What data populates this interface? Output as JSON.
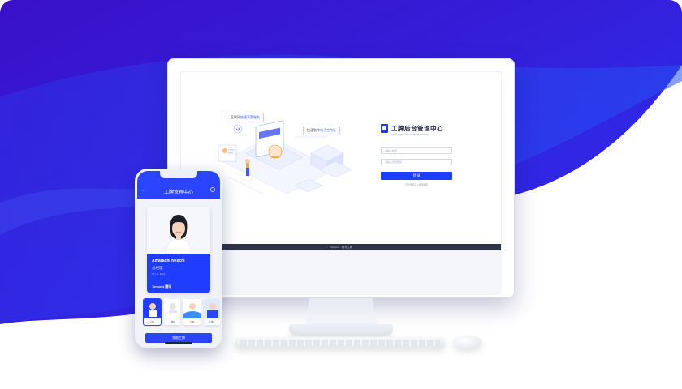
{
  "colors": {
    "brand_blue": "#1f3cff",
    "background_purple": "#3512d6",
    "background_blue": "#2a3ff0",
    "footer_dark": "#2d3446"
  },
  "desktop": {
    "illustration": {
      "callout_1": {
        "prefix": "互联网",
        "highlight": "快速享受服务",
        "suffix": ""
      },
      "callout_2": {
        "prefix": "快速制作",
        "highlight": "电子工作证",
        "suffix": ""
      }
    },
    "login": {
      "logo_icon": "id-card-icon",
      "title": "工牌后台管理中心",
      "subtitle": "WORK CARD MANAGEMENT CENTER",
      "username_placeholder": "请输入帐号",
      "password_placeholder": "请输入您的密码",
      "login_button": "登 录",
      "footer_links": "忘记密码？ | 找回密码"
    },
    "footer_text": "Tencent · 腾讯工牌"
  },
  "phone": {
    "back_label": "< ",
    "title": "工牌管理中心",
    "menu_icon": "more-icon",
    "card": {
      "name": "Amarachi Nkechi",
      "role": "总经理",
      "id_line": "NO.1 · 2021",
      "brand": "Tencent 腾讯"
    },
    "thumbnails": [
      {
        "caption": "工牌1"
      },
      {
        "caption": "工牌2"
      },
      {
        "caption": "工牌3"
      },
      {
        "caption": "工牌4"
      }
    ],
    "primary_button": "领取工牌"
  }
}
